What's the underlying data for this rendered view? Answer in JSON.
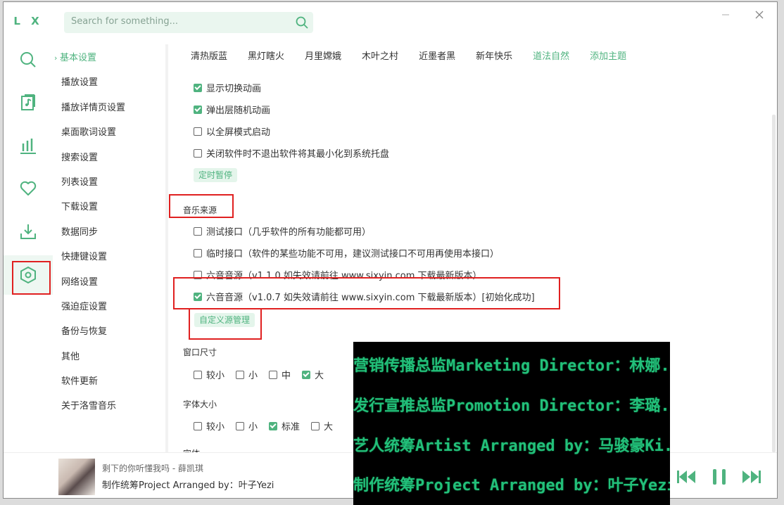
{
  "app": {
    "logo": "L X"
  },
  "colors": {
    "accent": "#4fb37f",
    "highlight_box": "#e02020",
    "overlay_text": "#22c07a"
  },
  "rail": [
    {
      "icon": "search-icon"
    },
    {
      "icon": "music-library-icon"
    },
    {
      "icon": "chart-icon"
    },
    {
      "icon": "heart-icon"
    },
    {
      "icon": "download-icon"
    },
    {
      "icon": "settings-icon",
      "active": true
    }
  ],
  "search": {
    "placeholder": "Search for something..."
  },
  "sidebar": {
    "items": [
      {
        "label": "基本设置",
        "active": true
      },
      {
        "label": "播放设置"
      },
      {
        "label": "播放详情页设置"
      },
      {
        "label": "桌面歌词设置"
      },
      {
        "label": "搜索设置"
      },
      {
        "label": "列表设置"
      },
      {
        "label": "下载设置"
      },
      {
        "label": "数据同步"
      },
      {
        "label": "快捷键设置"
      },
      {
        "label": "网络设置"
      },
      {
        "label": "强迫症设置"
      },
      {
        "label": "备份与恢复"
      },
      {
        "label": "其他"
      },
      {
        "label": "软件更新"
      },
      {
        "label": "关于洛雪音乐"
      }
    ]
  },
  "themes": {
    "items": [
      "清热版蓝",
      "黑灯瞎火",
      "月里嫦娥",
      "木叶之村",
      "近墨者黑",
      "新年快乐",
      "道法自然"
    ],
    "active": "道法自然",
    "add_label": "添加主题"
  },
  "general": {
    "show_switch_anim": {
      "label": "显示切换动画",
      "checked": true
    },
    "popup_random_anim": {
      "label": "弹出层随机动画",
      "checked": true
    },
    "fullscreen_start": {
      "label": "以全屏模式启动",
      "checked": false
    },
    "minimize_to_tray": {
      "label": "关闭软件时不退出软件将其最小化到系统托盘",
      "checked": false
    },
    "timer_pause_label": "定时暂停"
  },
  "music_source": {
    "title": "音乐来源",
    "options": [
      {
        "label": "测试接口（几乎软件的所有功能都可用）",
        "checked": false
      },
      {
        "label": "临时接口（软件的某些功能不可用，建议测试接口不可用再使用本接口）",
        "checked": false
      },
      {
        "label": "六音音源（v1.1.0 如失效请前往 www.sixyin.com 下载最新版本）",
        "checked": false
      },
      {
        "label": "六音音源（v1.0.7 如失效请前往 www.sixyin.com 下载最新版本）[初始化成功]",
        "checked": true
      }
    ],
    "custom_source_label": "自定义源管理"
  },
  "window_size": {
    "title": "窗口尺寸",
    "options": [
      {
        "label": "较小",
        "checked": false
      },
      {
        "label": "小",
        "checked": false
      },
      {
        "label": "中",
        "checked": false
      },
      {
        "label": "大",
        "checked": true
      }
    ]
  },
  "font_size": {
    "title": "字体大小",
    "options": [
      {
        "label": "较小",
        "checked": false
      },
      {
        "label": "小",
        "checked": false
      },
      {
        "label": "标准",
        "checked": true
      },
      {
        "label": "大",
        "checked": false
      }
    ],
    "next_title_partial": "字体"
  },
  "player": {
    "song": "剩下的你听懂我吗 - 薛凯琪",
    "lyric": "制作统筹Project Arranged by：叶子Yezi",
    "controls": [
      "prev-icon",
      "pause-icon",
      "next-icon"
    ]
  },
  "overlay": {
    "lines": [
      "营销传播总监Marketing Director：林娜...",
      "发行宣推总监Promotion Director：李璐...",
      "艺人统筹Artist Arranged by：马骏豪Ki...",
      "制作统筹Project Arranged by：叶子Yezi"
    ]
  }
}
